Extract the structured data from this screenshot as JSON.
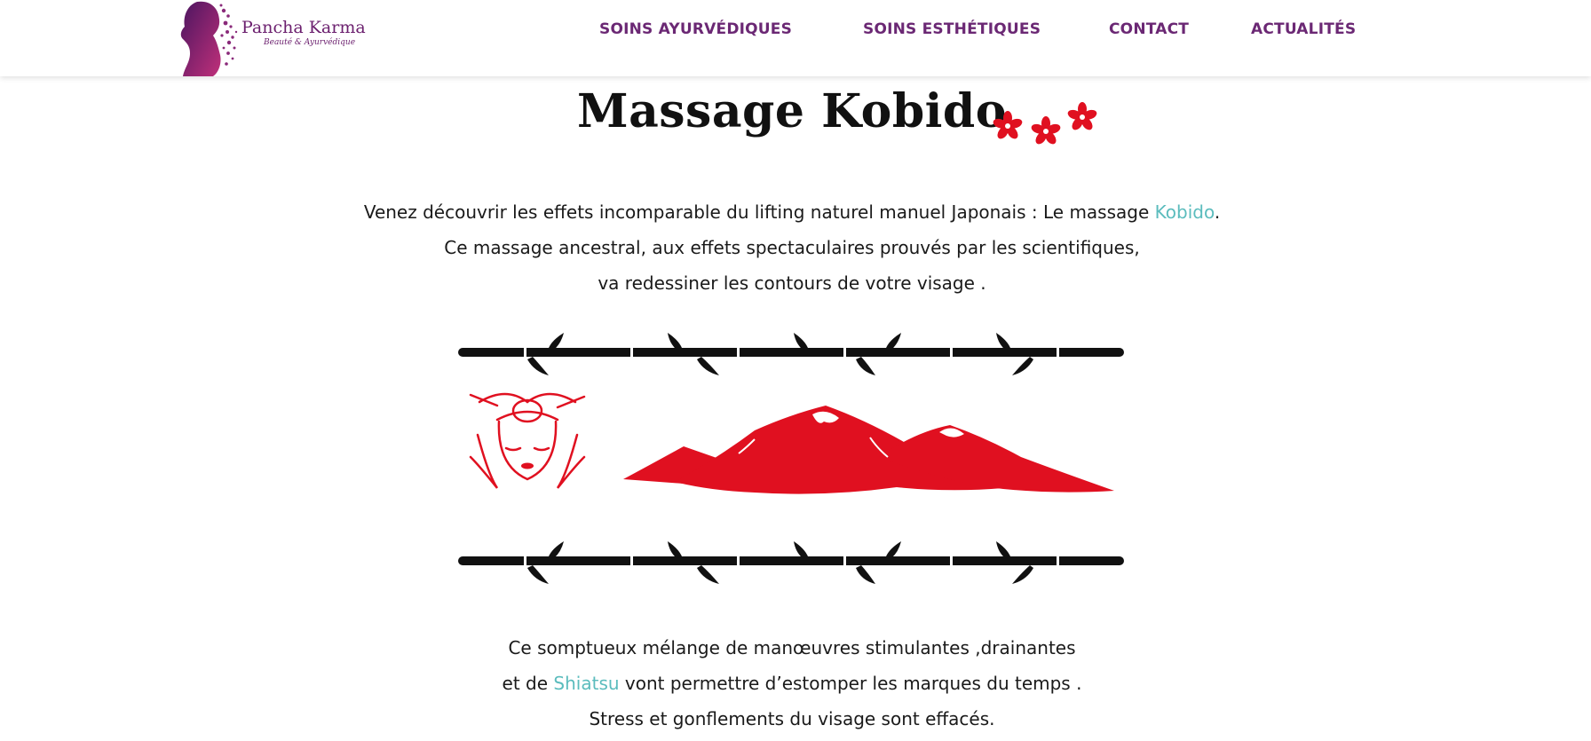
{
  "header": {
    "logo": {
      "name": "Pancha Karma",
      "tagline": "Beauté & Ayurvédique"
    },
    "nav": [
      {
        "label": "SOINS AYURVÉDIQUES"
      },
      {
        "label": "SOINS ESTHÉTIQUES"
      },
      {
        "label": "CONTACT"
      },
      {
        "label": "ACTUALITÉS"
      }
    ]
  },
  "main": {
    "title": "Massage Kobido",
    "intro": {
      "line1_before": "Venez découvrir les effets incomparable du lifting naturel manuel Japonais : Le massage ",
      "line1_link": "Kobido",
      "line1_after": ".",
      "line2": "Ce massage ancestral, aux effets spectaculaires prouvés par les scientifiques,",
      "line3": "va redessiner les contours de votre visage ."
    },
    "outro": {
      "line1": "Ce somptueux mélange de manœuvres stimulantes ,drainantes",
      "line2_before": "et de ",
      "line2_link": "Shiatsu",
      "line2_after": " vont permettre d’estomper les marques du temps .",
      "line3": "Stress et gonflements du visage sont effacés."
    }
  },
  "colors": {
    "brand_purple": "#6b2874",
    "link_teal": "#5bbcbd",
    "accent_red": "#e01020",
    "bamboo_black": "#111111"
  }
}
